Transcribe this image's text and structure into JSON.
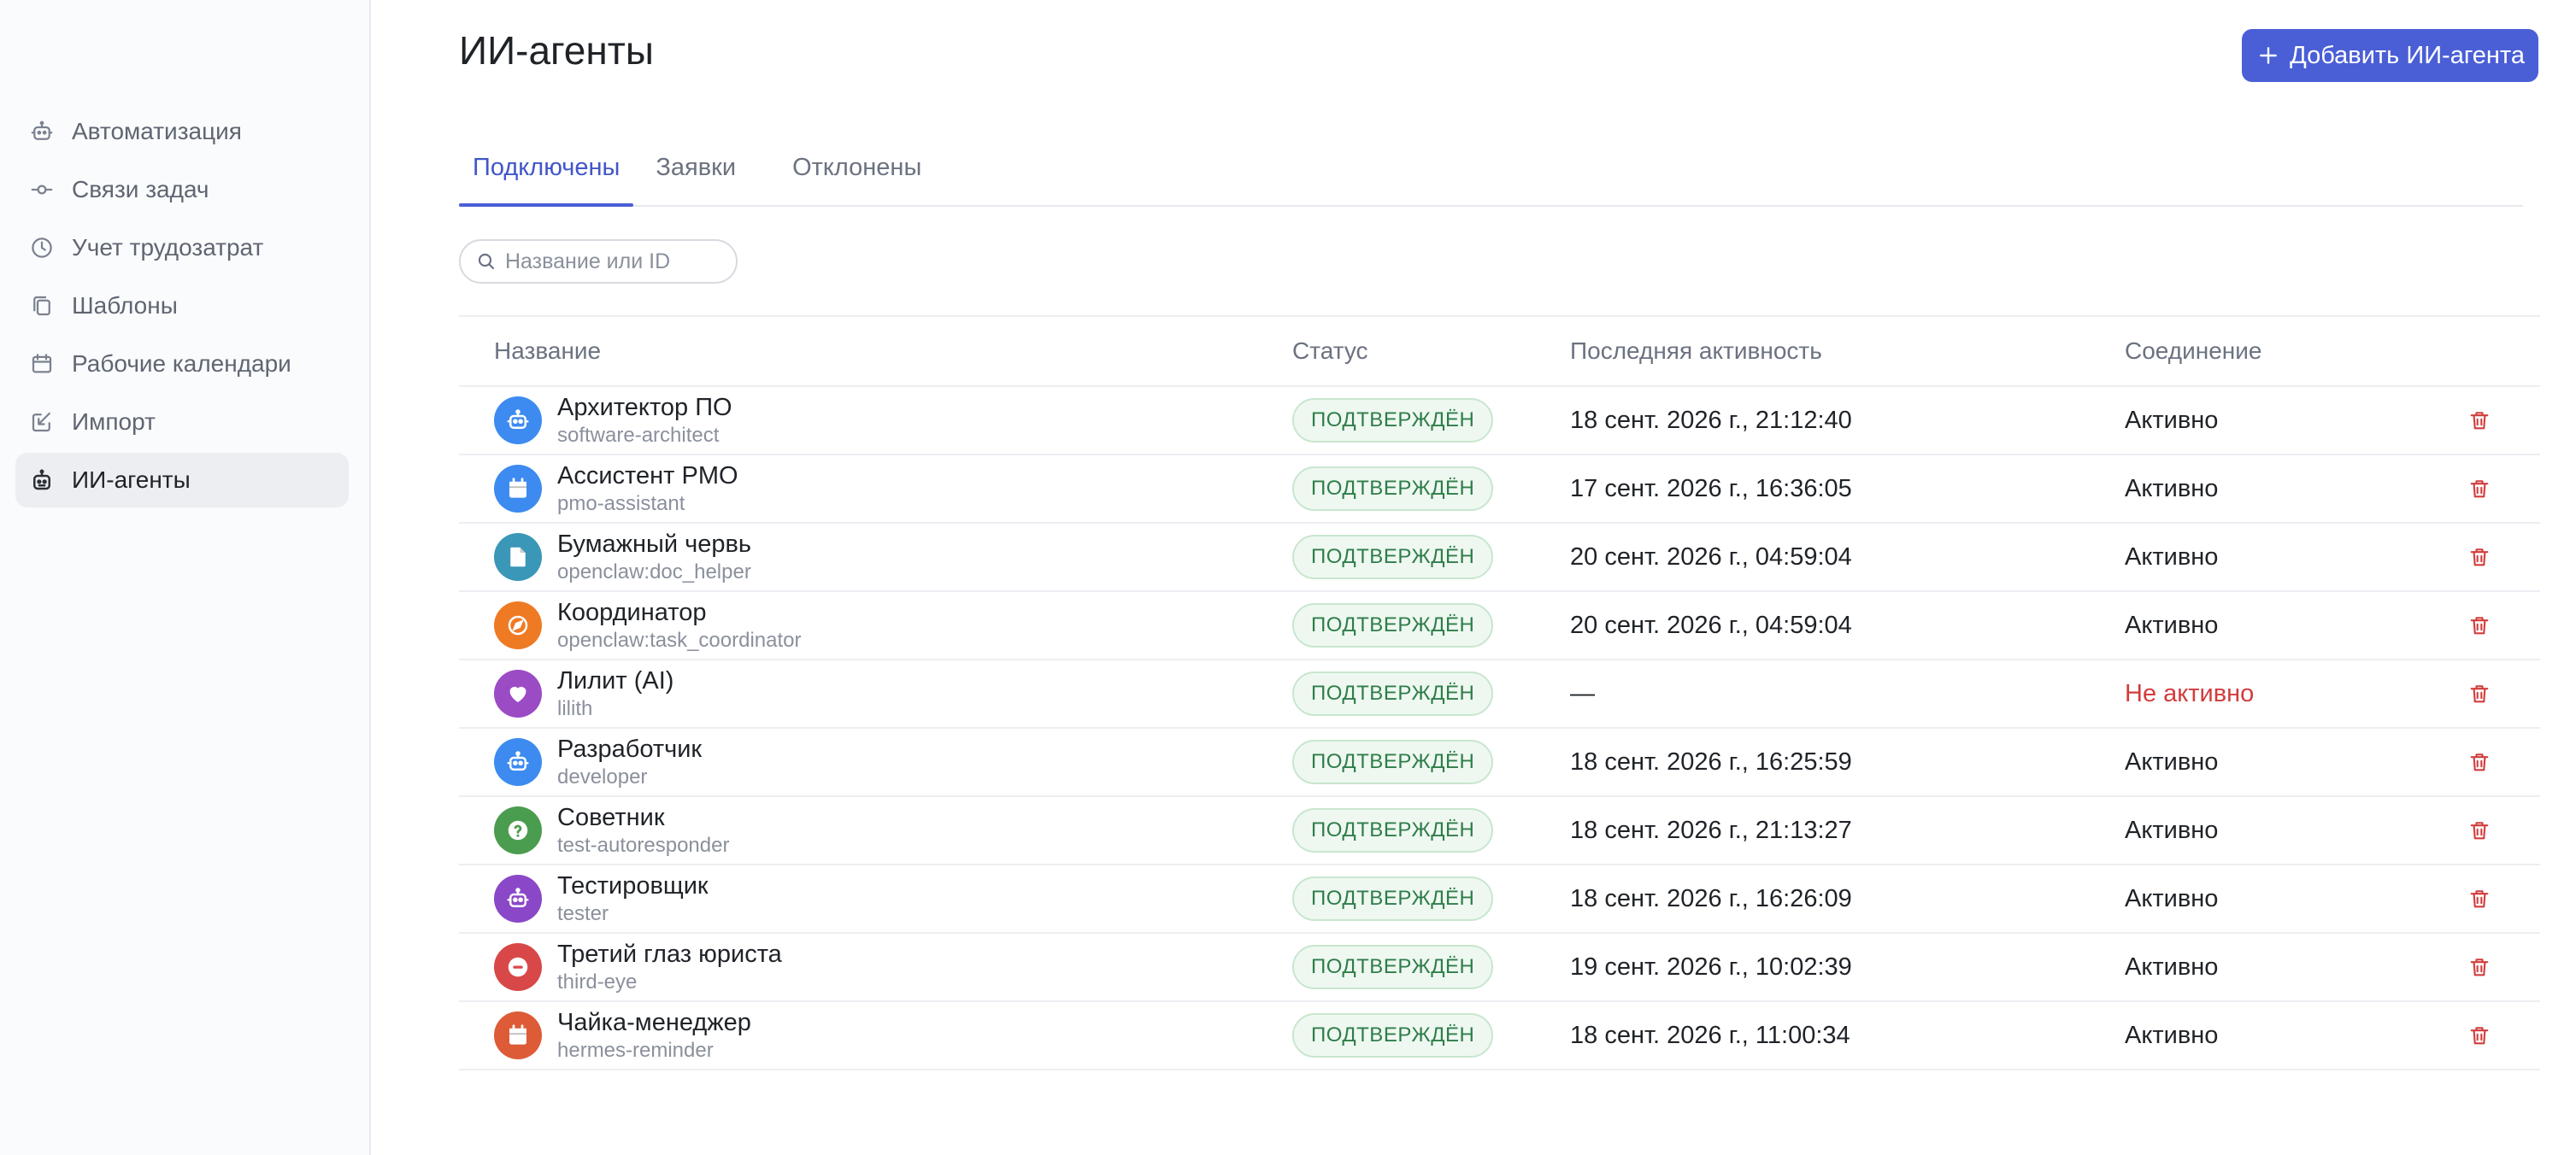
{
  "sidebar": {
    "items": [
      {
        "label": "Автоматизация",
        "icon": "robot-icon"
      },
      {
        "label": "Связи задач",
        "icon": "commit-icon"
      },
      {
        "label": "Учет трудозатрат",
        "icon": "clock-icon"
      },
      {
        "label": "Шаблоны",
        "icon": "copy-icon"
      },
      {
        "label": "Рабочие календари",
        "icon": "calendar-icon"
      },
      {
        "label": "Импорт",
        "icon": "import-icon"
      },
      {
        "label": "ИИ-агенты",
        "icon": "bot-icon",
        "active": true
      }
    ]
  },
  "header": {
    "title": "ИИ-агенты",
    "add_button_label": "Добавить ИИ-агента"
  },
  "tabs": [
    {
      "label": "Подключены",
      "active": true
    },
    {
      "label": "Заявки"
    },
    {
      "label": "Отклонены"
    }
  ],
  "search": {
    "placeholder": "Название или ID",
    "value": ""
  },
  "table": {
    "columns": [
      "Название",
      "Статус",
      "Последняя активность",
      "Соединение"
    ],
    "rows": [
      {
        "name": "Архитектор ПО",
        "id": "software-architect",
        "status": "ПОДТВЕРЖДЁН",
        "activity": "18 сент. 2026 г., 21:12:40",
        "connection": "Активно",
        "avatar_color": "#3d8bf0",
        "avatar_icon": "robot-icon"
      },
      {
        "name": "Ассистент PMO",
        "id": "pmo-assistant",
        "status": "ПОДТВЕРЖДЁН",
        "activity": "17 сент. 2026 г., 16:36:05",
        "connection": "Активно",
        "avatar_color": "#3d8bf0",
        "avatar_icon": "calendar-icon"
      },
      {
        "name": "Бумажный червь",
        "id": "openclaw:doc_helper",
        "status": "ПОДТВЕРЖДЁН",
        "activity": "20 сент. 2026 г., 04:59:04",
        "connection": "Активно",
        "avatar_color": "#3a97b7",
        "avatar_icon": "document-icon"
      },
      {
        "name": "Координатор",
        "id": "openclaw:task_coordinator",
        "status": "ПОДТВЕРЖДЁН",
        "activity": "20 сент. 2026 г., 04:59:04",
        "connection": "Активно",
        "avatar_color": "#ef7a24",
        "avatar_icon": "compass-icon"
      },
      {
        "name": "Лилит (AI)",
        "id": "lilith",
        "status": "ПОДТВЕРЖДЁН",
        "activity": "—",
        "connection": "Не активно",
        "inactive": true,
        "avatar_color": "#9b4bc4",
        "avatar_icon": "heart-icon"
      },
      {
        "name": "Разработчик",
        "id": "developer",
        "status": "ПОДТВЕРЖДЁН",
        "activity": "18 сент. 2026 г., 16:25:59",
        "connection": "Активно",
        "avatar_color": "#3d8bf0",
        "avatar_icon": "robot-icon"
      },
      {
        "name": "Советник",
        "id": "test-autoresponder",
        "status": "ПОДТВЕРЖДЁН",
        "activity": "18 сент. 2026 г., 21:13:27",
        "connection": "Активно",
        "avatar_color": "#4a9c4e",
        "avatar_icon": "question-icon"
      },
      {
        "name": "Тестировщик",
        "id": "tester",
        "status": "ПОДТВЕРЖДЁН",
        "activity": "18 сент. 2026 г., 16:26:09",
        "connection": "Активно",
        "avatar_color": "#8a48c8",
        "avatar_icon": "robot-icon"
      },
      {
        "name": "Третий глаз юриста",
        "id": "third-eye",
        "status": "ПОДТВЕРЖДЁН",
        "activity": "19 сент. 2026 г., 10:02:39",
        "connection": "Активно",
        "avatar_color": "#d84848",
        "avatar_icon": "minus-circle-icon"
      },
      {
        "name": "Чайка-менеджер",
        "id": "hermes-reminder",
        "status": "ПОДТВЕРЖДЁН",
        "activity": "18 сент. 2026 г., 11:00:34",
        "connection": "Активно",
        "avatar_color": "#de5b37",
        "avatar_icon": "calendar-icon",
        "hover": true
      }
    ]
  },
  "colors": {
    "accent": "#4a5fd6",
    "success": "#2e7d4a",
    "danger": "#d23c3c"
  }
}
